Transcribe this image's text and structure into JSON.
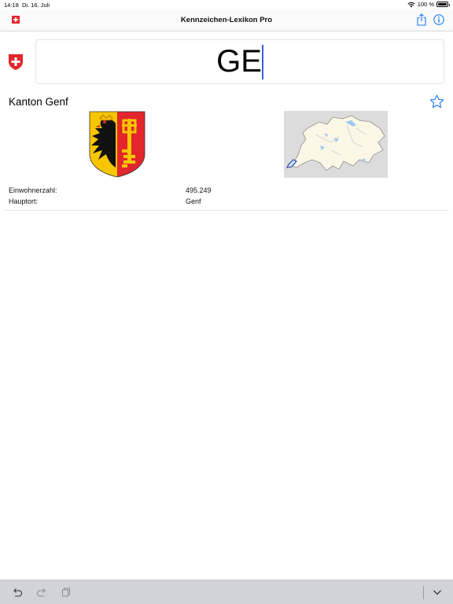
{
  "status": {
    "time": "14:18",
    "date": "Di. 16. Juli",
    "battery": "100 %",
    "battery_level": 1.0
  },
  "nav": {
    "title": "Kennzeichen-Lexikon Pro",
    "icons": [
      "swiss-flag-icon",
      "share-icon",
      "info-icon"
    ]
  },
  "search": {
    "value": "GE",
    "flag_icon": "swiss-shield-icon"
  },
  "canton": {
    "title": "Kanton Genf",
    "favorite_icon": "star-outline-icon",
    "images": [
      "coat-of-arms-geneva",
      "switzerland-locator-map"
    ],
    "facts": [
      {
        "label": "Einwohnerzahl:",
        "value": "495.249"
      },
      {
        "label": "Hauptort:",
        "value": "Genf"
      }
    ]
  },
  "toolbar": {
    "icons": [
      "undo-icon",
      "redo-icon",
      "paste-icon",
      "dismiss-keyboard-icon"
    ]
  },
  "colors": {
    "accent": "#1a7cf5",
    "swiss_red": "#e3262b",
    "caret": "#3b5fe0",
    "toolbar_bg": "#d1d3d9"
  }
}
